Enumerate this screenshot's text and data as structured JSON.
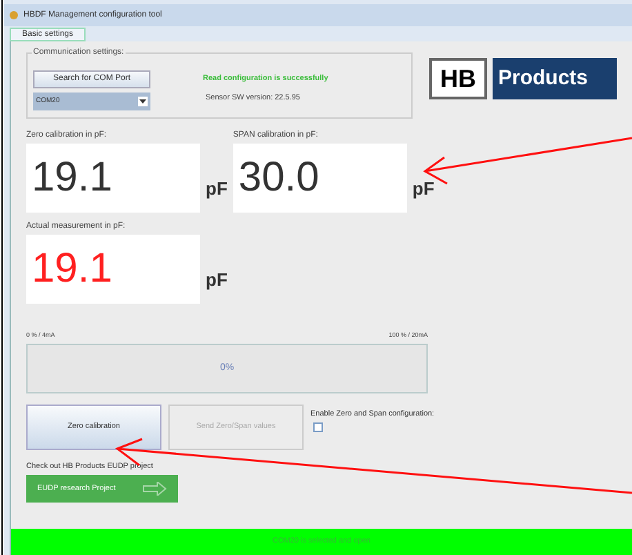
{
  "window": {
    "title": "HBDF Management configuration tool"
  },
  "tabs": [
    {
      "label": "Basic settings",
      "selected": true
    }
  ],
  "communication": {
    "title": "Communication settings:",
    "search_button": "Search for COM Port",
    "port": "COM20",
    "status": "Read configuration is successfully",
    "version": "Sensor SW version: 22.5.95"
  },
  "logo": {
    "left": "HB",
    "right": "Products"
  },
  "zero": {
    "label": "Zero calibration in pF:",
    "value": "19.1",
    "unit": "pF"
  },
  "span": {
    "label": "SPAN calibration in pF:",
    "value": "30.0",
    "unit": "pF"
  },
  "actual": {
    "label": "Actual measurement in pF:",
    "value": "19.1",
    "unit": "pF"
  },
  "progress": {
    "min_label": "0 % / 4mA",
    "max_label": "100 % / 20mA",
    "text": "0%",
    "level": 0
  },
  "buttons": [
    {
      "label": "Zero calibration",
      "disabled": false
    },
    {
      "label": "Send Zero/Span values",
      "disabled": true
    }
  ],
  "enable": {
    "label": "Enable Zero and Span configuration:",
    "checked": false
  },
  "project": {
    "label": "Check out HB Products EUDP project",
    "button": "EUDP research Project"
  },
  "status_bar": "COM20 is selected and open"
}
